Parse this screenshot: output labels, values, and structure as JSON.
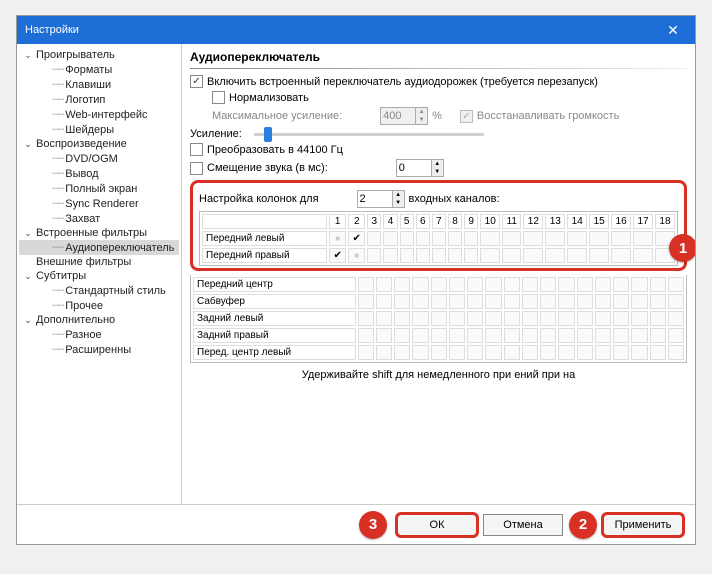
{
  "window": {
    "title": "Настройки"
  },
  "tree": {
    "items": [
      {
        "label": "Проигрыватель",
        "level": 0,
        "expandable": true
      },
      {
        "label": "Форматы",
        "level": 1
      },
      {
        "label": "Клавиши",
        "level": 1
      },
      {
        "label": "Логотип",
        "level": 1
      },
      {
        "label": "Web-интерфейс",
        "level": 1
      },
      {
        "label": "Шейдеры",
        "level": 1
      },
      {
        "label": "Воспроизведение",
        "level": 0,
        "expandable": true
      },
      {
        "label": "DVD/OGM",
        "level": 1
      },
      {
        "label": "Вывод",
        "level": 1
      },
      {
        "label": "Полный экран",
        "level": 1
      },
      {
        "label": "Sync Renderer",
        "level": 1
      },
      {
        "label": "Захват",
        "level": 1
      },
      {
        "label": "Встроенные фильтры",
        "level": 0,
        "expandable": true
      },
      {
        "label": "Аудиопереключатель",
        "level": 1,
        "selected": true
      },
      {
        "label": "Внешние фильтры",
        "level": 0
      },
      {
        "label": "Субтитры",
        "level": 0,
        "expandable": true
      },
      {
        "label": "Стандартный стиль",
        "level": 1
      },
      {
        "label": "Прочее",
        "level": 1
      },
      {
        "label": "Дополнительно",
        "level": 0,
        "expandable": true
      },
      {
        "label": "Разное",
        "level": 1
      },
      {
        "label": "Расширенны",
        "level": 1
      }
    ]
  },
  "panel": {
    "title": "Аудиопереключатель",
    "enable_label": "Включить встроенный переключатель аудиодорожек (требуется перезапуск)",
    "normalize_label": "Нормализовать",
    "max_gain_label": "Максимальное усиление:",
    "max_gain_value": "400",
    "percent": "%",
    "restore_volume_label": "Восстанавливать громкость",
    "gain_label": "Усиление:",
    "downsample_label": "Преобразовать в 44100 Гц",
    "audio_delay_label": "Смещение звука (в мс):",
    "audio_delay_value": "0",
    "speaker_config_prefix": "Настройка колонок для",
    "speaker_config_value": "2",
    "speaker_config_suffix": "входных каналов:",
    "matrix_rows": [
      "Передний левый",
      "Передний правый",
      "Передний центр",
      "Сабвуфер",
      "Задний левый",
      "Задний правый",
      "Перед. центр левый"
    ],
    "matrix_cols": [
      "1",
      "2",
      "3",
      "4",
      "5",
      "6",
      "7",
      "8",
      "9",
      "10",
      "11",
      "12",
      "13",
      "14",
      "15",
      "16",
      "17",
      "18"
    ],
    "hint": "Удерживайте shift для немедленного при                     ений при на"
  },
  "buttons": {
    "ok": "ОК",
    "cancel": "Отмена",
    "apply": "Применить"
  },
  "markers": {
    "m1": "1",
    "m2": "2",
    "m3": "3"
  }
}
